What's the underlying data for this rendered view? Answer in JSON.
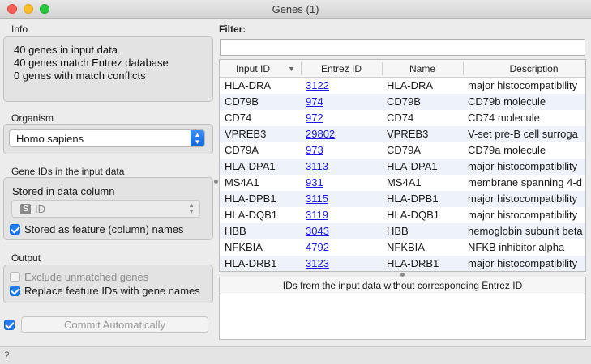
{
  "window": {
    "title": "Genes (1)"
  },
  "info": {
    "label": "Info",
    "lines": [
      "40 genes in input data",
      "40 genes match Entrez database",
      "0 genes with match conflicts"
    ]
  },
  "organism": {
    "label": "Organism",
    "selected": "Homo sapiens"
  },
  "gene_ids": {
    "label": "Gene IDs in the input data",
    "stored_in_column_label": "Stored in data column",
    "column_type_badge": "S",
    "column_value": "ID",
    "stored_as_feature_label": "Stored as feature (column) names",
    "stored_as_feature_checked": true
  },
  "output": {
    "label": "Output",
    "exclude_unmatched_label": "Exclude unmatched genes",
    "exclude_unmatched_checked": false,
    "replace_ids_label": "Replace feature IDs with gene names",
    "replace_ids_checked": true
  },
  "commit": {
    "label": "Commit Automatically",
    "auto_checked": true
  },
  "filter": {
    "label": "Filter:",
    "value": ""
  },
  "table": {
    "columns": [
      "Input ID",
      "Entrez ID",
      "Name",
      "Description"
    ],
    "rows": [
      [
        "HLA-DRA",
        "3122",
        "HLA-DRA",
        "major histocompatibility"
      ],
      [
        "CD79B",
        "974",
        "CD79B",
        "CD79b molecule"
      ],
      [
        "CD74",
        "972",
        "CD74",
        "CD74 molecule"
      ],
      [
        "VPREB3",
        "29802",
        "VPREB3",
        "V-set pre-B cell surroga"
      ],
      [
        "CD79A",
        "973",
        "CD79A",
        "CD79a molecule"
      ],
      [
        "HLA-DPA1",
        "3113",
        "HLA-DPA1",
        "major histocompatibility"
      ],
      [
        "MS4A1",
        "931",
        "MS4A1",
        "membrane spanning 4-d"
      ],
      [
        "HLA-DPB1",
        "3115",
        "HLA-DPB1",
        "major histocompatibility"
      ],
      [
        "HLA-DQB1",
        "3119",
        "HLA-DQB1",
        "major histocompatibility"
      ],
      [
        "HBB",
        "3043",
        "HBB",
        "hemoglobin subunit beta"
      ],
      [
        "NFKBIA",
        "4792",
        "NFKBIA",
        "NFKB inhibitor alpha"
      ],
      [
        "HLA-DRB1",
        "3123",
        "HLA-DRB1",
        "major histocompatibility"
      ]
    ]
  },
  "unmatched_panel": {
    "header": "IDs from the input data without corresponding Entrez ID"
  },
  "status": {
    "help_icon": "?"
  }
}
